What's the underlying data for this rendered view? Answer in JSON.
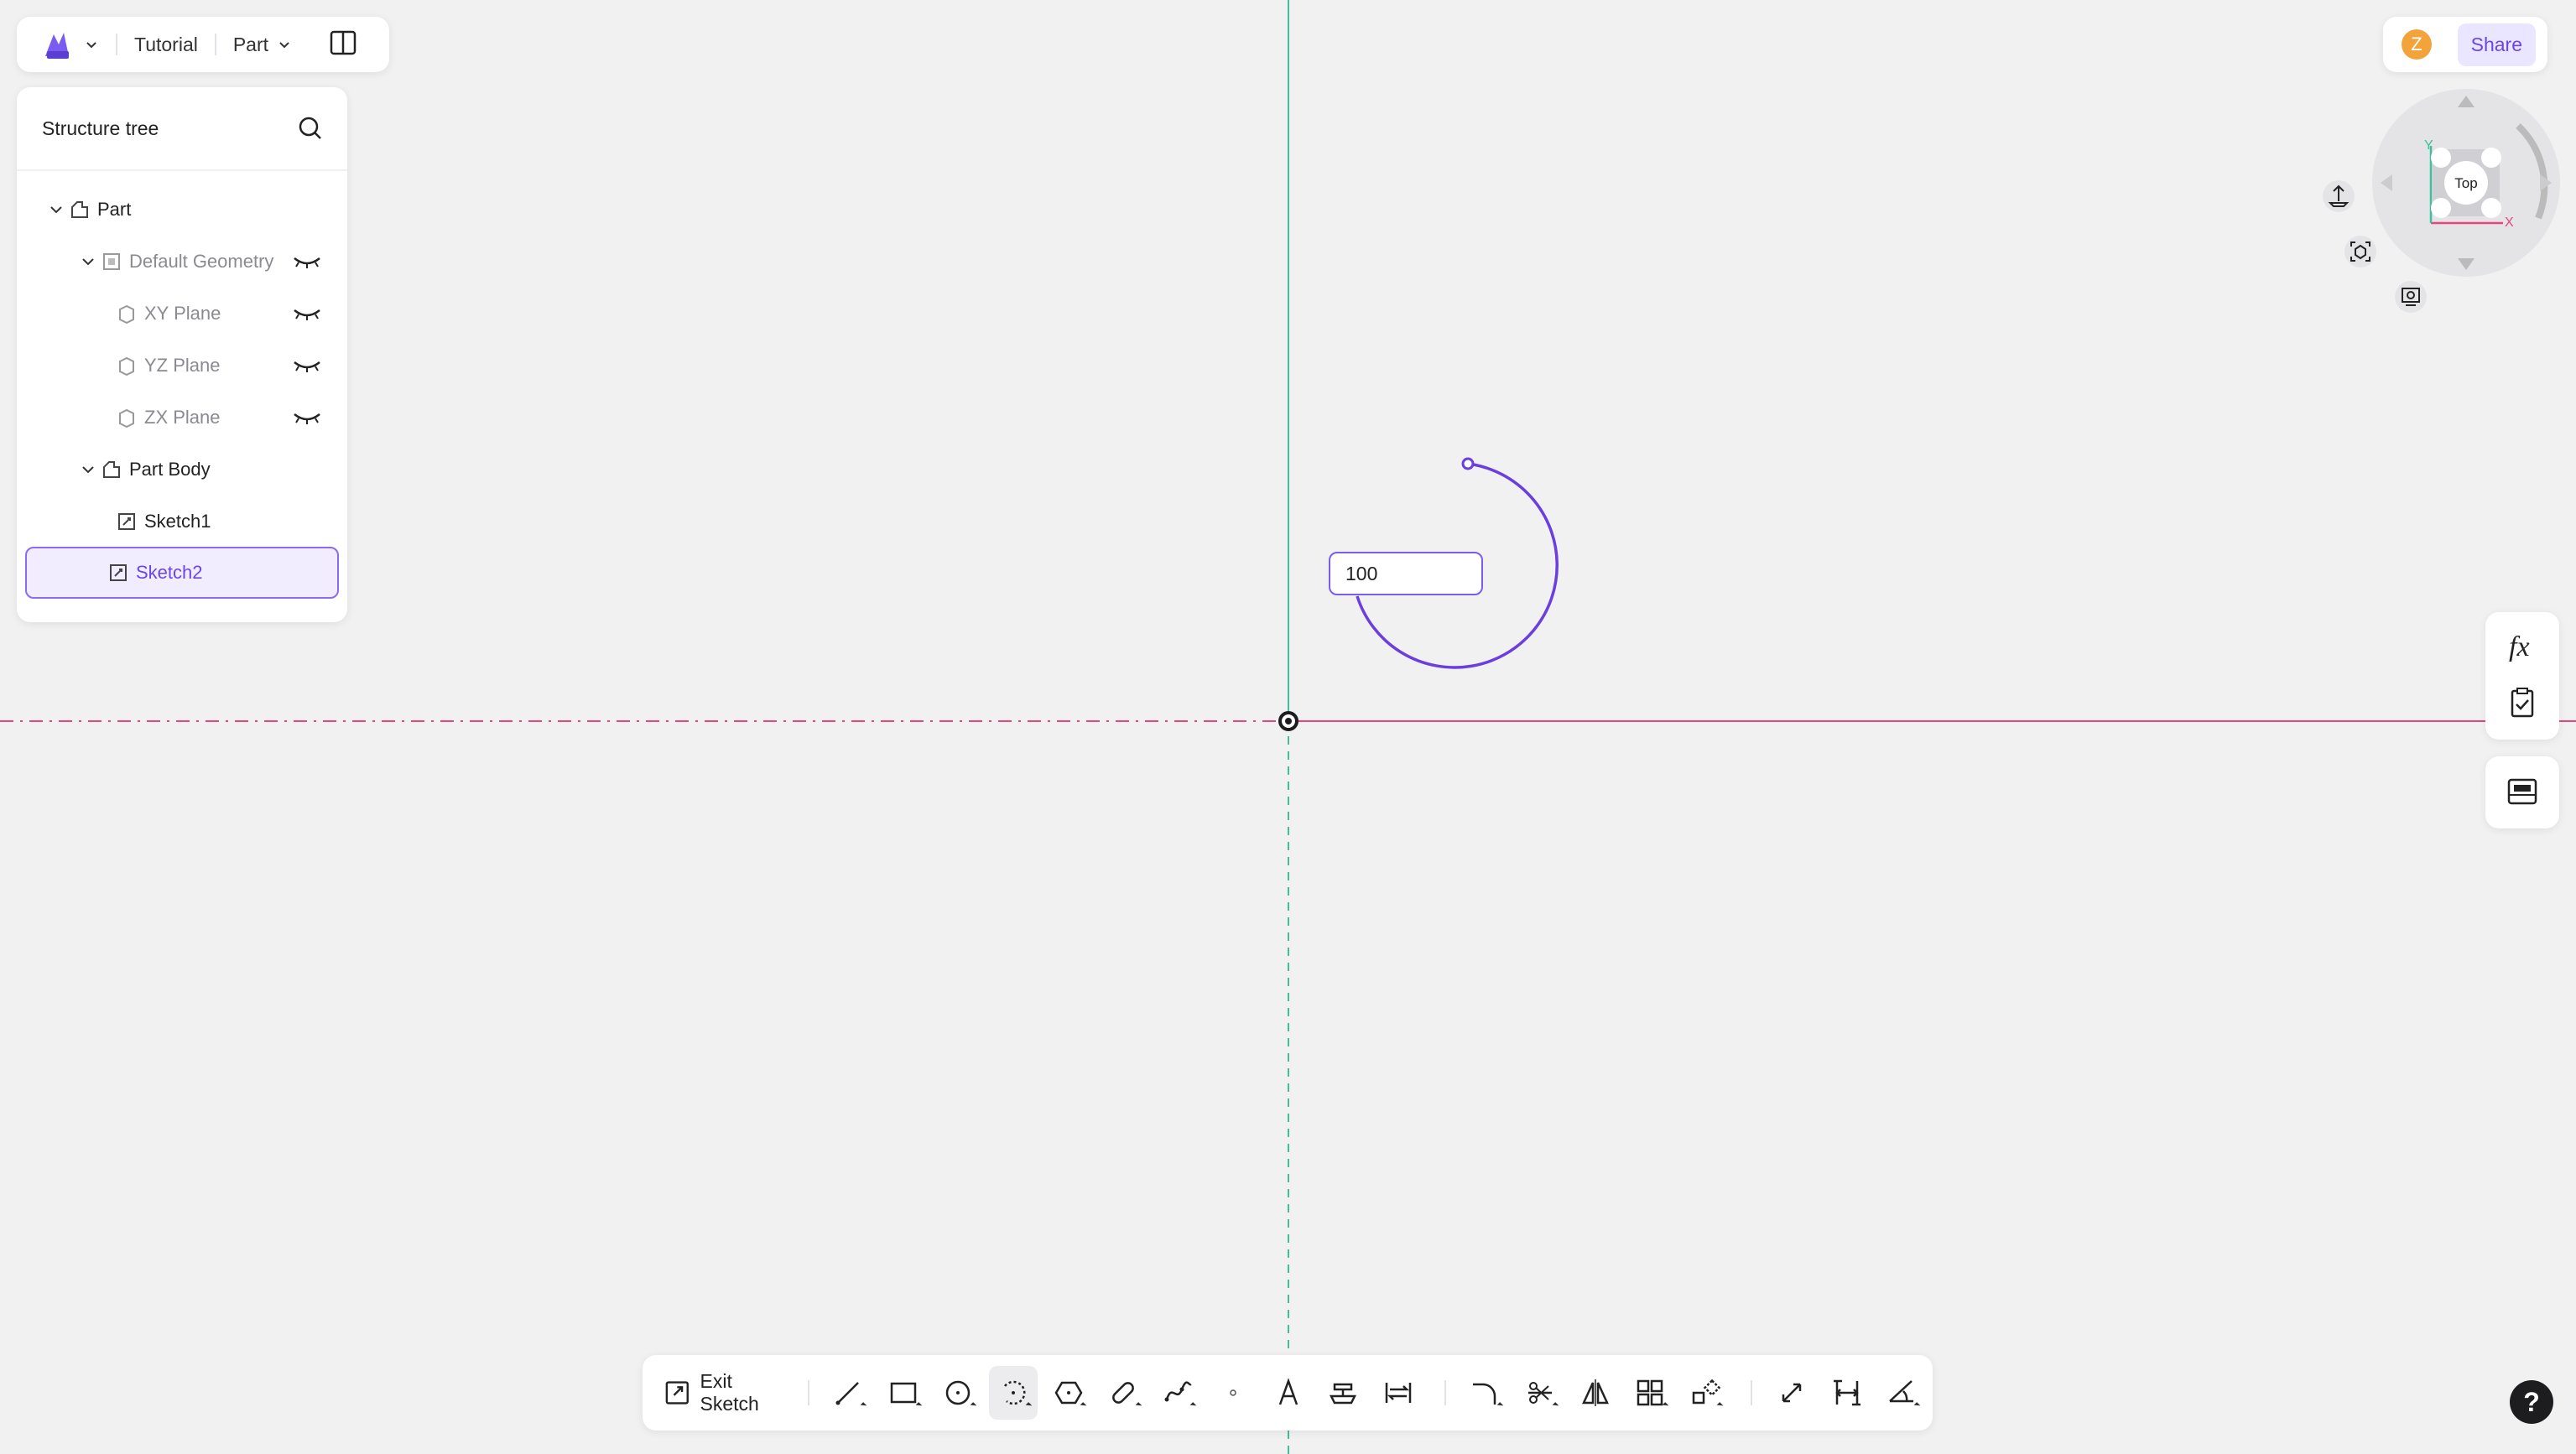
{
  "header": {
    "tutorial_label": "Tutorial",
    "part_label": "Part"
  },
  "tree": {
    "title": "Structure tree",
    "rows": [
      {
        "label": "Part"
      },
      {
        "label": "Default Geometry"
      },
      {
        "label": "XY Plane"
      },
      {
        "label": "YZ Plane"
      },
      {
        "label": "ZX Plane"
      },
      {
        "label": "Part Body"
      },
      {
        "label": "Sketch1"
      },
      {
        "label": "Sketch2"
      }
    ]
  },
  "topright": {
    "avatar_letter": "Z",
    "share_label": "Share"
  },
  "viewcube": {
    "face_label": "Top",
    "axis_x": "X",
    "axis_y": "Y"
  },
  "canvas": {
    "dimension_value": "100"
  },
  "toolbar": {
    "exit_label": "Exit Sketch"
  },
  "help": {
    "label": "?"
  },
  "colors": {
    "accent": "#6b45e8",
    "axis_x": "#e8457a",
    "axis_y": "#3fbf9c",
    "arc": "#6b3ee0"
  }
}
